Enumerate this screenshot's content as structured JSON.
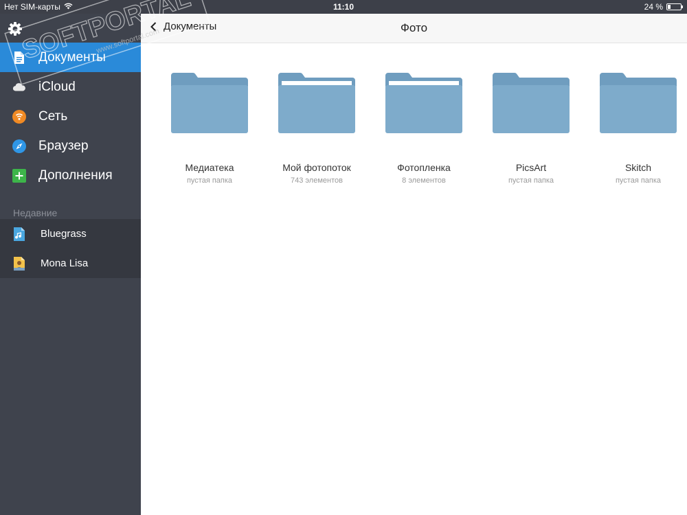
{
  "status": {
    "carrier": "Нет SIM-карты",
    "time": "11:10",
    "battery": "24 %",
    "battery_level": 0.24
  },
  "sidebar": {
    "items": [
      {
        "label": "Документы",
        "icon": "document-icon",
        "active": true
      },
      {
        "label": "iCloud",
        "icon": "cloud-icon"
      },
      {
        "label": "Сеть",
        "icon": "wifi-network-icon"
      },
      {
        "label": "Браузер",
        "icon": "compass-icon"
      },
      {
        "label": "Дополнения",
        "icon": "plus-icon"
      }
    ],
    "recent_title": "Недавние",
    "recent": [
      {
        "label": "Bluegrass",
        "icon": "music-file-icon"
      },
      {
        "label": "Mona Lisa",
        "icon": "image-file-icon"
      }
    ]
  },
  "navbar": {
    "back_label": "Документы",
    "title": "Фото"
  },
  "folders": [
    {
      "name": "Медиатека",
      "sub": "пустая папка"
    },
    {
      "name": "Мой фотопоток",
      "sub": "743 элементов"
    },
    {
      "name": "Фотопленка",
      "sub": "8 элементов"
    },
    {
      "name": "PicsArt",
      "sub": "пустая папка"
    },
    {
      "name": "Skitch",
      "sub": "пустая папка"
    }
  ],
  "watermark": {
    "brand": "SOFTPORTAL",
    "url": "www.softportal.com",
    "tm": "TM"
  },
  "colors": {
    "accent": "#2a8ad9",
    "sidebar_bg": "#3f434d",
    "folder": "#7ea9c9"
  }
}
